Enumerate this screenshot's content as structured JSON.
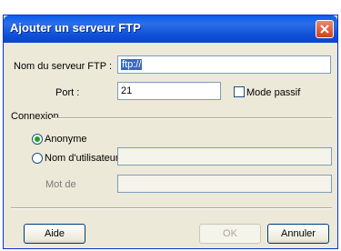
{
  "dialog": {
    "title": "Ajouter un serveur FTP",
    "server_label": "Nom du serveur FTP :",
    "server_value": "ftp://",
    "port_label": "Port :",
    "port_value": "21",
    "passive_label": "Mode passif",
    "connection_label": "Connexion",
    "anonymous_label": "Anonyme",
    "username_label": "Nom d'utilisateur",
    "username_value": "",
    "password_label": "Mot de",
    "password_value": "",
    "help_label": "Aide",
    "ok_label": "OK",
    "cancel_label": "Annuler"
  }
}
